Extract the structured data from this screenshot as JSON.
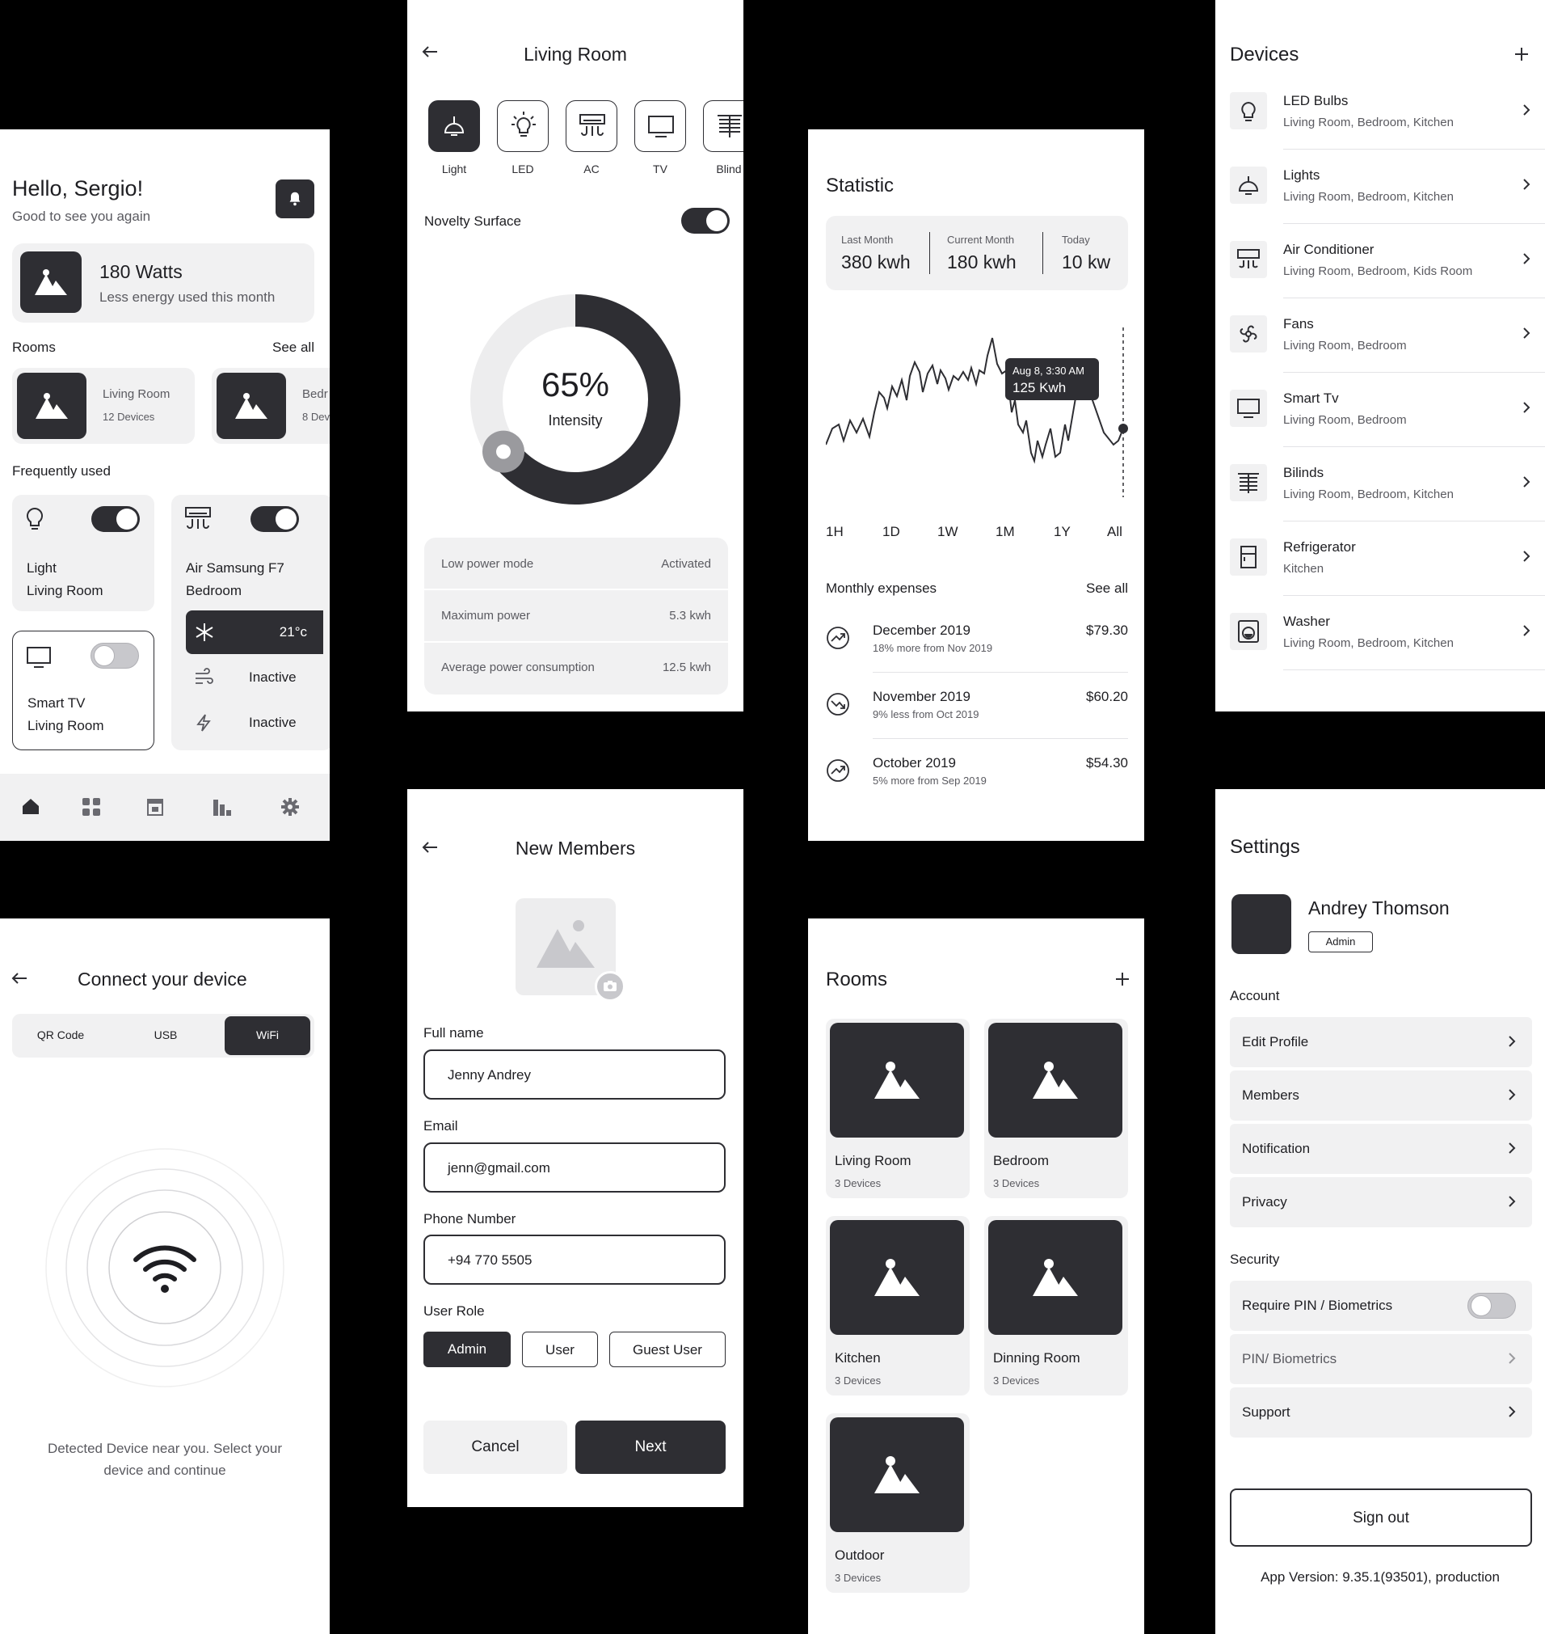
{
  "home": {
    "greeting": "Hello, Sergio!",
    "subtitle": "Good to see you again",
    "energy_value": "180 Watts",
    "energy_caption": "Less energy used this month",
    "rooms_label": "Rooms",
    "see_all": "See all",
    "rooms": [
      {
        "name": "Living Room",
        "devices": "12 Devices"
      },
      {
        "name": "Bedr",
        "devices": "8 Dev"
      }
    ],
    "frequently_used": "Frequently used",
    "light_card": {
      "name": "Light",
      "room": "Living Room"
    },
    "ac_card": {
      "name": "Air Samsung F7",
      "room": "Bedroom",
      "temp": "21°c",
      "fan_status": "Inactive",
      "power_status": "Inactive"
    },
    "tv_card": {
      "name": "Smart TV",
      "room": "Living Room"
    }
  },
  "living_room": {
    "title": "Living Room",
    "device_tabs": [
      "Light",
      "LED",
      "AC",
      "TV",
      "Blind"
    ],
    "surface_label": "Novelty Surface",
    "intensity_value": "65%",
    "intensity_label": "Intensity",
    "intensity_fraction": 0.65,
    "rows": [
      {
        "label": "Low power mode",
        "value": "Activated"
      },
      {
        "label": "Maximum power",
        "value": "5.3 kwh"
      },
      {
        "label": "Average power consumption",
        "value": "12.5 kwh"
      }
    ]
  },
  "statistic": {
    "title": "Statistic",
    "summary": [
      {
        "label": "Last Month",
        "value": "380 kwh"
      },
      {
        "label": "Current Month",
        "value": "180 kwh"
      },
      {
        "label": "Today",
        "value": "10 kw"
      }
    ],
    "tooltip_date": "Aug 8, 3:30 AM",
    "tooltip_value": "125 Kwh",
    "ranges": [
      "1H",
      "1D",
      "1W",
      "1M",
      "1Y",
      "All"
    ],
    "expenses_label": "Monthly expenses",
    "see_all": "See all",
    "expenses": [
      {
        "month": "December 2019",
        "note": "18% more from Nov 2019",
        "amount": "$79.30",
        "trend": "up"
      },
      {
        "month": "November 2019",
        "note": "9% less from Oct 2019",
        "amount": "$60.20",
        "trend": "down"
      },
      {
        "month": "October 2019",
        "note": "5% more from Sep 2019",
        "amount": "$54.30",
        "trend": "up"
      }
    ]
  },
  "devices": {
    "title": "Devices",
    "items": [
      {
        "name": "LED Bulbs",
        "rooms": "Living Room, Bedroom, Kitchen",
        "icon": "bulb-icon"
      },
      {
        "name": "Lights",
        "rooms": "Living Room, Bedroom, Kitchen",
        "icon": "lamp-icon"
      },
      {
        "name": "Air Conditioner",
        "rooms": "Living Room, Bedroom, Kids Room",
        "icon": "ac-icon"
      },
      {
        "name": "Fans",
        "rooms": "Living Room, Bedroom",
        "icon": "fan-icon"
      },
      {
        "name": "Smart Tv",
        "rooms": "Living Room, Bedroom",
        "icon": "tv-icon"
      },
      {
        "name": "Bilinds",
        "rooms": "Living Room, Bedroom, Kitchen",
        "icon": "blinds-icon"
      },
      {
        "name": "Refrigerator",
        "rooms": "Kitchen",
        "icon": "fridge-icon"
      },
      {
        "name": "Washer",
        "rooms": "Living Room, Bedroom, Kitchen",
        "icon": "washer-icon"
      }
    ]
  },
  "connect": {
    "title": "Connect your device",
    "tabs": [
      "QR Code",
      "USB",
      "WiFi"
    ],
    "message": "Detected Device near you. Select your device and continue"
  },
  "new_members": {
    "title": "New Members",
    "full_name_label": "Full name",
    "full_name": "Jenny Andrey",
    "email_label": "Email",
    "email": "jenn@gmail.com",
    "phone_label": "Phone Number",
    "phone": "+94 770 5505",
    "role_label": "User Role",
    "roles": [
      "Admin",
      "User",
      "Guest User"
    ],
    "cancel": "Cancel",
    "next": "Next"
  },
  "rooms": {
    "title": "Rooms",
    "items": [
      {
        "name": "Living Room",
        "devices": "3 Devices"
      },
      {
        "name": "Bedroom",
        "devices": "3 Devices"
      },
      {
        "name": "Kitchen",
        "devices": "3 Devices"
      },
      {
        "name": "Dinning Room",
        "devices": "3 Devices"
      },
      {
        "name": "Outdoor",
        "devices": "3 Devices"
      }
    ]
  },
  "settings": {
    "title": "Settings",
    "user_name": "Andrey Thomson",
    "user_role": "Admin",
    "account_label": "Account",
    "account_items": [
      "Edit Profile",
      "Members",
      "Notification",
      "Privacy"
    ],
    "security_label": "Security",
    "security_items": [
      "Require PIN / Biometrics",
      "PIN/ Biometrics",
      "Support"
    ],
    "sign_out": "Sign out",
    "app_version": "App Version: 9.35.1(93501), production"
  }
}
